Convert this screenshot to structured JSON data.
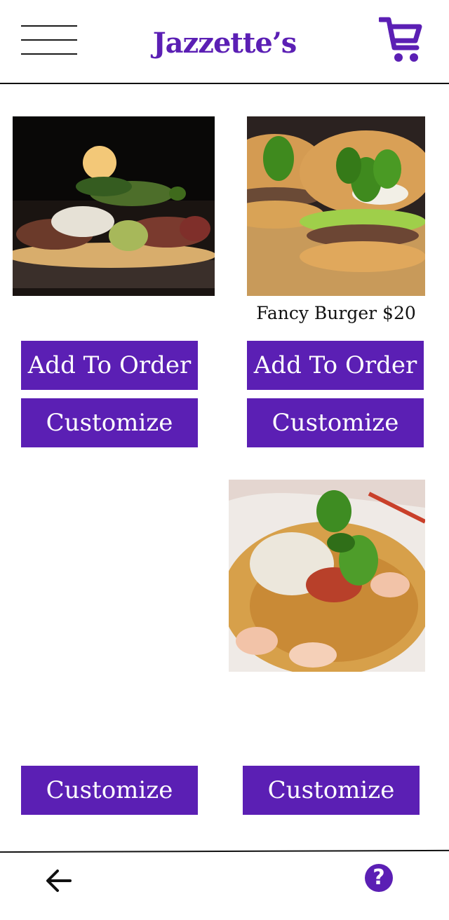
{
  "header": {
    "title": "Jazzette’s",
    "menu_icon": "hamburger-menu-icon",
    "cart_icon": "shopping-cart-icon"
  },
  "menu_items": [
    {
      "image": "tacos-photo",
      "caption": "",
      "add_label": "Add To Order",
      "customize_label": "Customize"
    },
    {
      "image": "burger-photo",
      "caption": "Fancy Burger $20",
      "add_label": "Add To Order",
      "customize_label": "Customize"
    },
    {
      "image": "",
      "caption": "",
      "customize_label": "Customize"
    },
    {
      "image": "pasta-photo",
      "caption": "",
      "customize_label": "Customize"
    }
  ],
  "footer": {
    "back_icon": "arrow-left-icon",
    "help_icon": "question-mark-icon",
    "help_glyph": "?"
  },
  "colors": {
    "accent": "#5b1fb4",
    "text": "#111111",
    "background": "#ffffff"
  }
}
